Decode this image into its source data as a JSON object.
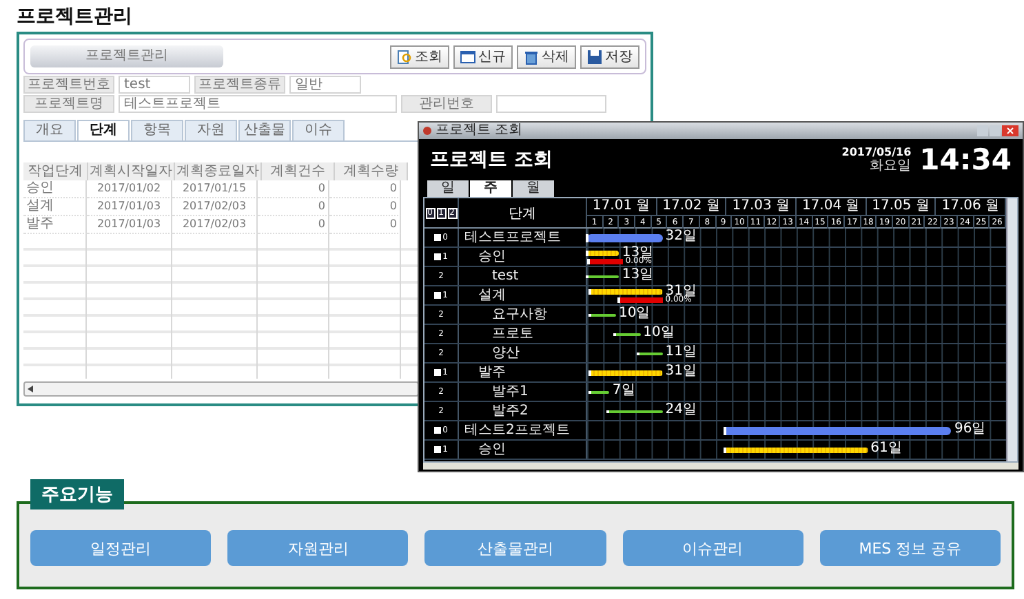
{
  "page_title": "프로젝트관리",
  "project_panel": {
    "header": "프로젝트관리",
    "buttons": [
      {
        "label": "조회",
        "kind": "search"
      },
      {
        "label": "신규",
        "kind": "new"
      },
      {
        "label": "삭제",
        "kind": "delete"
      },
      {
        "label": "저장",
        "kind": "save"
      }
    ],
    "form_rows": [
      [
        {
          "label": "프로젝트번호",
          "value": "test"
        },
        {
          "label": "프로젝트종류",
          "value": "일반"
        }
      ],
      [
        {
          "label": "프로젝트명",
          "value": "테스트프로젝트",
          "wide": true
        },
        {
          "label": "관리번호"
        }
      ]
    ],
    "tabs": [
      {
        "label": "개요",
        "selected": false
      },
      {
        "label": "단계",
        "selected": true
      },
      {
        "label": "항목",
        "selected": false
      },
      {
        "label": "자원",
        "selected": false
      },
      {
        "label": "산출물",
        "selected": false
      },
      {
        "label": "이슈",
        "selected": false
      }
    ],
    "table": {
      "columns": [
        "작업단계",
        "계획시작일자",
        "계획종료일자",
        "계획건수",
        "계획수량"
      ],
      "rows": [
        [
          "승인",
          "2017/01/02",
          "2017/01/15",
          "0",
          "0"
        ],
        [
          "설계",
          "2017/01/03",
          "2017/02/03",
          "0",
          "0"
        ],
        [
          "발주",
          "2017/01/03",
          "2017/02/03",
          "0",
          "0"
        ]
      ]
    }
  },
  "gantt_window": {
    "title": "프로젝트 조회",
    "heading": "프로젝트 조회",
    "date": "2017/05/16",
    "weekday": "화요일",
    "time": "14:34",
    "tabs": [
      {
        "label": "일",
        "selected": false
      },
      {
        "label": "주",
        "selected": true
      },
      {
        "label": "월",
        "selected": false
      }
    ],
    "level_buttons": [
      "0",
      "1",
      "2"
    ],
    "name_header": "단계",
    "months": [
      "17.01 월",
      "17.02 월",
      "17.03 월",
      "17.04 월",
      "17.05 월",
      "17.06 월"
    ],
    "weeks": [
      "1",
      "2",
      "3",
      "4",
      "5",
      "6",
      "7",
      "8",
      "9",
      "10",
      "11",
      "12",
      "13",
      "14",
      "15",
      "16",
      "17",
      "18",
      "19",
      "20",
      "21",
      "22",
      "23",
      "24",
      "25",
      "26"
    ],
    "rows": [
      {
        "number": "0",
        "name": "테스트프로젝트",
        "bars": [
          {
            "kind": "project",
            "start": {
              "level": 0
            },
            "end": {
              "level": 0.18
            },
            "label": "32일"
          }
        ],
        "children": [
          {
            "number": "1",
            "name": "승인",
            "bars": [
              {
                "kind": "phase",
                "start": {
                  "level": 0
                },
                "end": {
                  "level": 0.077
                },
                "label": "13일"
              },
              {
                "kind": "progress",
                "start": {
                  "level": 0.004
                },
                "end": {
                  "level": 0.085
                },
                "label": "0.00%"
              }
            ],
            "children": [
              {
                "number": "2",
                "name": "test",
                "bars": [
                  {
                    "kind": "task",
                    "start": {
                      "level": 0
                    },
                    "end": {
                      "level": 0.077
                    },
                    "label": "13일"
                  }
                ]
              }
            ]
          },
          {
            "number": "1",
            "name": "설계",
            "bars": [
              {
                "kind": "phase",
                "start": {
                  "level": 0.008
                },
                "end": {
                  "level": 0.18
                },
                "label": "31일"
              },
              {
                "kind": "progress",
                "start": {
                  "level": 0.077
                },
                "end": {
                  "level": 0.18
                },
                "label": "0.00%"
              }
            ],
            "children": [
              {
                "number": "2",
                "name": "요구사항",
                "bars": [
                  {
                    "kind": "task",
                    "start": {
                      "level": 0.008
                    },
                    "end": {
                      "level": 0.069
                    },
                    "label": "10일"
                  }
                ]
              },
              {
                "number": "2",
                "name": "프로토",
                "bars": [
                  {
                    "kind": "task",
                    "start": {
                      "level": 0.065
                    },
                    "end": {
                      "level": 0.127
                    },
                    "label": "10일"
                  }
                ]
              },
              {
                "number": "2",
                "name": "양산",
                "bars": [
                  {
                    "kind": "task",
                    "start": {
                      "level": 0.123
                    },
                    "end": {
                      "level": 0.18
                    },
                    "label": "11일"
                  }
                ]
              }
            ]
          },
          {
            "number": "1",
            "name": "발주",
            "bars": [
              {
                "kind": "phase",
                "start": {
                  "level": 0.008
                },
                "end": {
                  "level": 0.18
                },
                "label": "31일"
              }
            ],
            "children": [
              {
                "number": "2",
                "name": "발주1",
                "bars": [
                  {
                    "kind": "task",
                    "start": {
                      "level": 0.008
                    },
                    "end": {
                      "level": 0.054
                    },
                    "label": "7일"
                  }
                ]
              },
              {
                "number": "2",
                "name": "발주2",
                "bars": [
                  {
                    "kind": "task",
                    "start": {
                      "level": 0.05
                    },
                    "end": {
                      "level": 0.18
                    },
                    "label": "24일"
                  }
                ]
              }
            ]
          }
        ]
      },
      {
        "number": "0",
        "name": "테스트2프로젝트",
        "bars": [
          {
            "kind": "project",
            "start": {
              "level": 0.33
            },
            "end": {
              "level": 0.87
            },
            "label": "96일"
          }
        ],
        "children": [
          {
            "number": "1",
            "name": "승인",
            "bars": [
              {
                "kind": "phase",
                "start": {
                  "level": 0.33
                },
                "end": {
                  "level": 0.67
                },
                "label": "61일"
              }
            ]
          }
        ]
      }
    ]
  },
  "main_features": {
    "title": "주요기능",
    "buttons": [
      "일정관리",
      "자원관리",
      "산출물관리",
      "이슈관리",
      "MES 정보 공유"
    ]
  }
}
